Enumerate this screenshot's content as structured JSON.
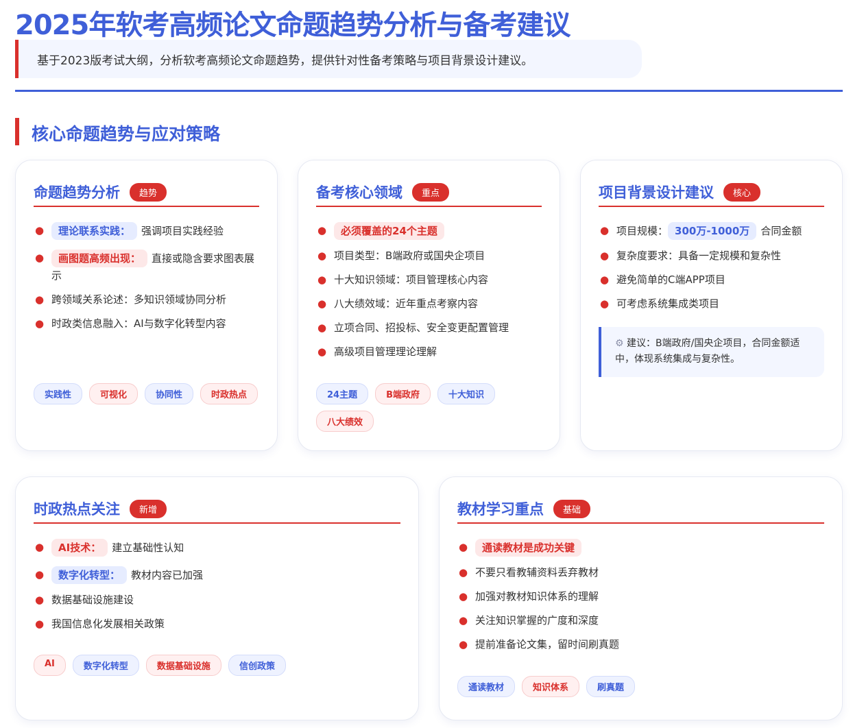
{
  "page": {
    "title": "2025年软考高频论文命题趋势分析与备考建议",
    "subtitle": "基于2023版考试大纲，分析软考高频论文命题趋势，提供针对性备考策略与项目背景设计建议。",
    "section_title": "核心命题趋势与应对策略"
  },
  "colors": {
    "primary": "#3f5fd8",
    "accent": "#d9302c"
  },
  "cards": [
    {
      "title": "命题趋势分析",
      "badge": "趋势",
      "items": [
        {
          "label": "理论联系实践：",
          "style": "blue",
          "text": "强调项目实践经验"
        },
        {
          "label": "画图题高频出现：",
          "style": "red",
          "text": "直接或隐含要求图表展示"
        },
        {
          "label": "",
          "style": "",
          "text": "跨领域关系论述：多知识领域协同分析"
        },
        {
          "label": "",
          "style": "",
          "text": "时政类信息融入：AI与数字化转型内容"
        }
      ],
      "tags": [
        {
          "text": "实践性",
          "style": "blue"
        },
        {
          "text": "可视化",
          "style": "red"
        },
        {
          "text": "协同性",
          "style": "blue"
        },
        {
          "text": "时政热点",
          "style": "red"
        }
      ]
    },
    {
      "title": "备考核心领域",
      "badge": "重点",
      "items": [
        {
          "label": "必须覆盖的24个主题",
          "style": "red",
          "text": ""
        },
        {
          "label": "",
          "style": "",
          "text": "项目类型：B端政府或国央企项目"
        },
        {
          "label": "",
          "style": "",
          "text": "十大知识领域：项目管理核心内容"
        },
        {
          "label": "",
          "style": "",
          "text": "八大绩效域：近年重点考察内容"
        },
        {
          "label": "",
          "style": "",
          "text": "立项合同、招投标、安全变更配置管理"
        },
        {
          "label": "",
          "style": "",
          "text": "高级项目管理理论理解"
        }
      ],
      "tags": [
        {
          "text": "24主题",
          "style": "blue"
        },
        {
          "text": "B端政府",
          "style": "red"
        },
        {
          "text": "十大知识",
          "style": "blue"
        },
        {
          "text": "八大绩效",
          "style": "red"
        }
      ]
    },
    {
      "title": "项目背景设计建议",
      "badge": "核心",
      "items": [
        {
          "prefix": "项目规模：",
          "label": "300万-1000万",
          "style": "blue",
          "text": "合同金额"
        },
        {
          "label": "",
          "style": "",
          "text": "复杂度要求：具备一定规模和复杂性"
        },
        {
          "label": "",
          "style": "",
          "text": "避免简单的C端APP项目"
        },
        {
          "label": "",
          "style": "",
          "text": "可考虑系统集成类项目"
        }
      ],
      "tip": {
        "icon": "gear-icon",
        "text": "建议：B端政府/国央企项目，合同金额适中，体现系统集成与复杂性。"
      }
    },
    {
      "title": "时政热点关注",
      "badge": "新增",
      "items": [
        {
          "label": "AI技术：",
          "style": "red",
          "text": "建立基础性认知"
        },
        {
          "label": "数字化转型：",
          "style": "blue",
          "text": "教材内容已加强"
        },
        {
          "label": "",
          "style": "",
          "text": "数据基础设施建设"
        },
        {
          "label": "",
          "style": "",
          "text": "我国信息化发展相关政策"
        }
      ],
      "tags": [
        {
          "text": "AI",
          "style": "red"
        },
        {
          "text": "数字化转型",
          "style": "blue"
        },
        {
          "text": "数据基础设施",
          "style": "red"
        },
        {
          "text": "信创政策",
          "style": "blue"
        }
      ]
    },
    {
      "title": "教材学习重点",
      "badge": "基础",
      "items": [
        {
          "label": "通读教材是成功关键",
          "style": "red",
          "text": ""
        },
        {
          "label": "",
          "style": "",
          "text": "不要只看教辅资料丢弃教材"
        },
        {
          "label": "",
          "style": "",
          "text": "加强对教材知识体系的理解"
        },
        {
          "label": "",
          "style": "",
          "text": "关注知识掌握的广度和深度"
        },
        {
          "label": "",
          "style": "",
          "text": "提前准备论文集，留时间刷真题"
        }
      ],
      "tags": [
        {
          "text": "通读教材",
          "style": "blue"
        },
        {
          "text": "知识体系",
          "style": "red"
        },
        {
          "text": "刷真题",
          "style": "blue"
        }
      ]
    }
  ]
}
